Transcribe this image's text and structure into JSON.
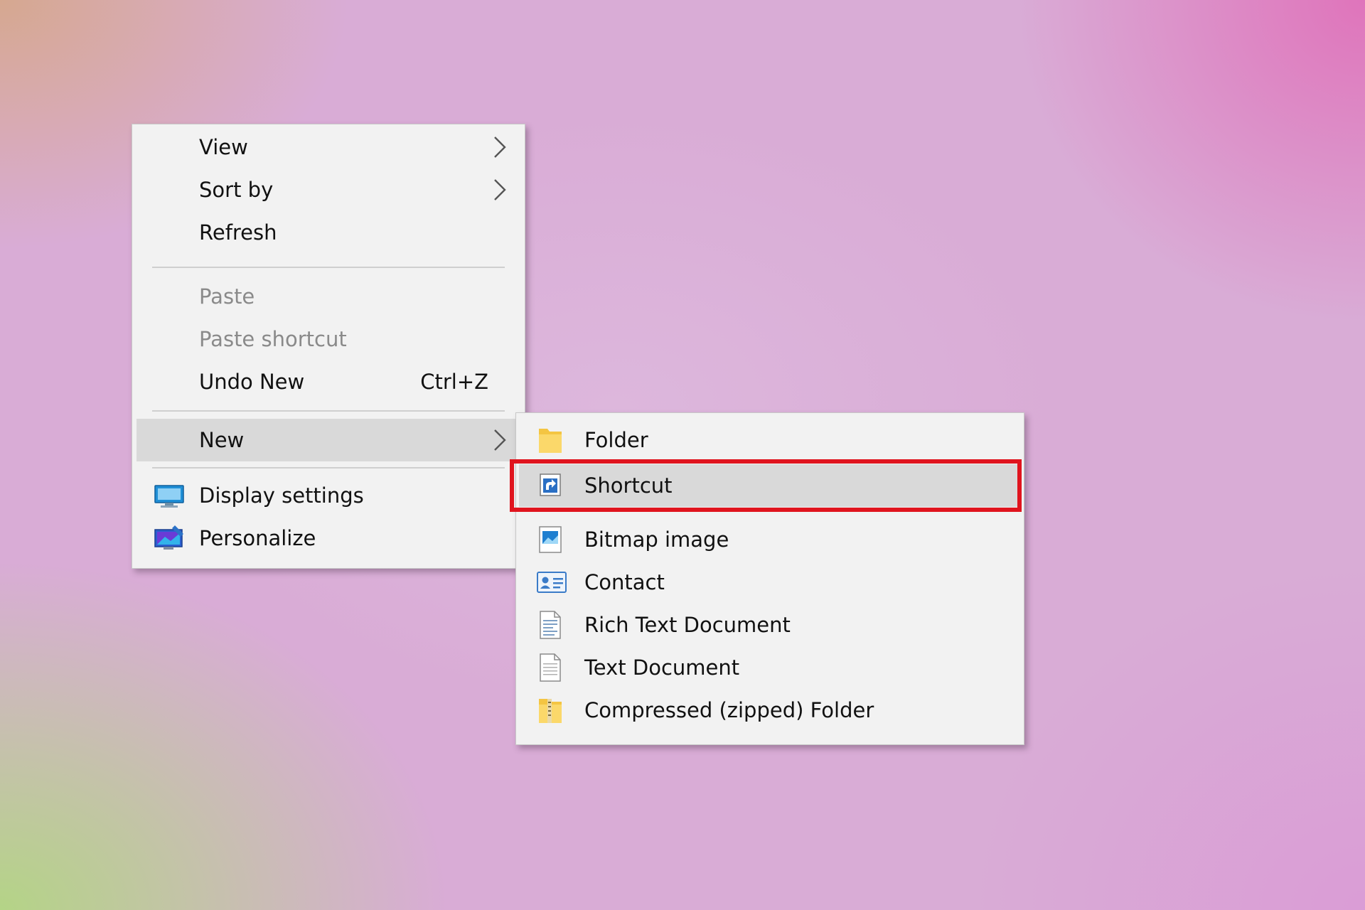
{
  "colors": {
    "menu_bg": "#f2f2f2",
    "hover_bg": "#d9d9d9",
    "disabled_text": "#8a8a8a",
    "highlight_border": "#e0141e"
  },
  "context_menu": {
    "view": "View",
    "sort_by": "Sort by",
    "refresh": "Refresh",
    "paste": "Paste",
    "paste_shortcut": "Paste shortcut",
    "undo_new": "Undo New",
    "undo_new_shortcut": "Ctrl+Z",
    "new": "New",
    "display_settings": "Display settings",
    "personalize": "Personalize"
  },
  "new_submenu": {
    "folder": "Folder",
    "shortcut": "Shortcut",
    "bitmap_image": "Bitmap image",
    "contact": "Contact",
    "rich_text_document": "Rich Text Document",
    "text_document": "Text Document",
    "compressed_folder": "Compressed (zipped) Folder"
  },
  "icons": {
    "chevron": "chevron-right-icon",
    "display_settings": "monitor-icon",
    "personalize": "personalize-icon",
    "folder": "folder-icon",
    "shortcut": "shortcut-arrow-icon",
    "bitmap_image": "bitmap-image-icon",
    "contact": "contact-card-icon",
    "rich_text_document": "rich-text-document-icon",
    "text_document": "text-document-icon",
    "compressed_folder": "zipped-folder-icon"
  }
}
